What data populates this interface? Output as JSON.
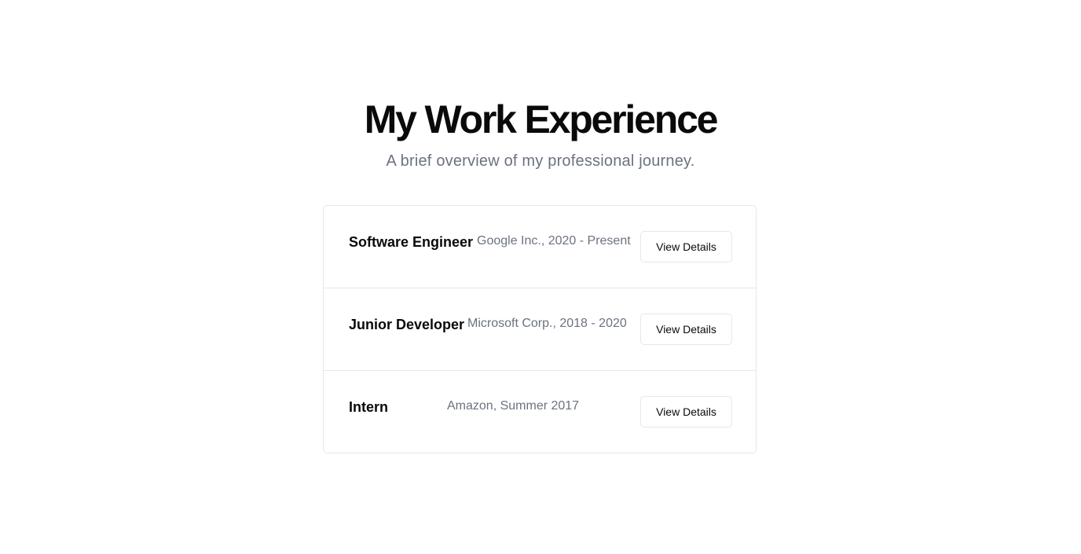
{
  "header": {
    "title": "My Work Experience",
    "subtitle": "A brief overview of my professional journey."
  },
  "experiences": [
    {
      "role": "Software Engineer",
      "company": "Google Inc., 2020 - Present",
      "button_label": "View Details"
    },
    {
      "role": "Junior Developer",
      "company": "Microsoft Corp., 2018 - 2020",
      "button_label": "View Details"
    },
    {
      "role": "Intern",
      "company": "Amazon, Summer 2017",
      "button_label": "View Details"
    }
  ],
  "colors": {
    "text": "#0a0a0a",
    "muted": "#6b7280",
    "border": "#e5e7eb",
    "background": "#ffffff"
  }
}
